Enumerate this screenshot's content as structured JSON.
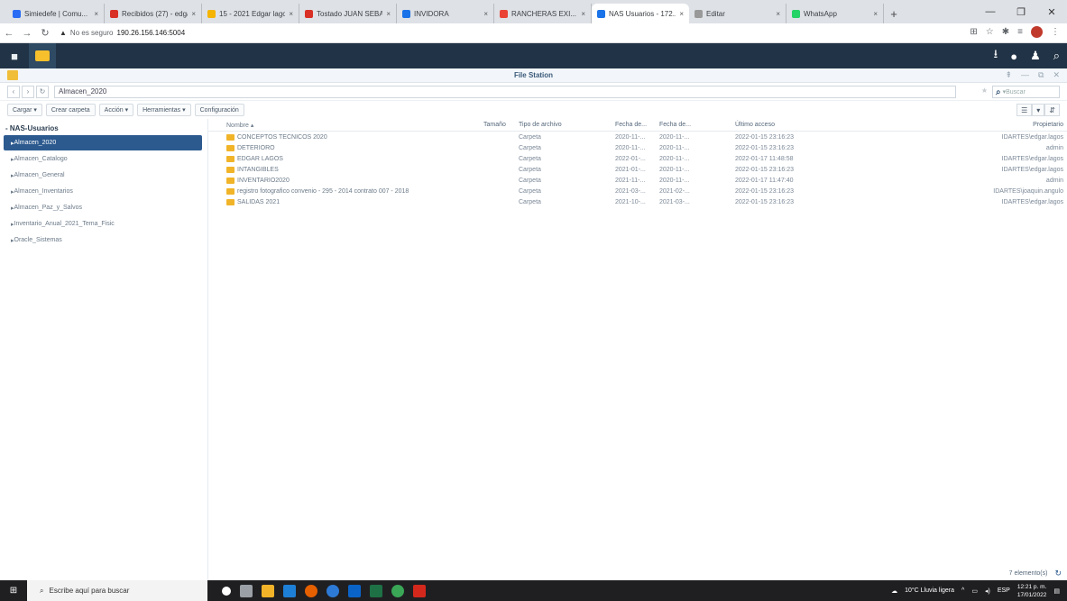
{
  "browser": {
    "tabs": [
      {
        "label": "Simiedefe | Comu...",
        "color": "#2a6df4",
        "active": false
      },
      {
        "label": "Recibidos (27) - edga...",
        "color": "#d93025",
        "active": false
      },
      {
        "label": "15 - 2021 Edgar lagos ...",
        "color": "#f4b400",
        "active": false
      },
      {
        "label": "Tostado JUAN SEBAS...",
        "color": "#d93025",
        "active": false
      },
      {
        "label": "INVIDORA",
        "color": "#1a73e8",
        "active": false
      },
      {
        "label": "RANCHERAS EXI...",
        "color": "#ea4335",
        "active": false
      },
      {
        "label": "NAS Usuarios - 172...",
        "color": "#1a73e8",
        "active": true
      },
      {
        "label": "Editar",
        "color": "#999999",
        "active": false
      },
      {
        "label": "WhatsApp",
        "color": "#25d366",
        "active": false
      }
    ],
    "url_warning": "No es seguro",
    "url_host": "190.26.156.146:5004"
  },
  "app": {
    "title": "File Station",
    "path": "Almacen_2020",
    "search_placeholder": "Buscar"
  },
  "toolbar": {
    "upload": "Cargar ▾",
    "create_folder": "Crear carpeta",
    "action": "Acción ▾",
    "tools": "Herramientas ▾",
    "settings": "Configuración"
  },
  "sidebar": {
    "root": "NAS-Usuarios",
    "items": [
      {
        "label": "Almacen_2020",
        "selected": true
      },
      {
        "label": "Almacen_Catalogo",
        "selected": false
      },
      {
        "label": "Almacen_General",
        "selected": false
      },
      {
        "label": "Almacen_Inventarios",
        "selected": false
      },
      {
        "label": "Almacen_Paz_y_Salvos",
        "selected": false
      },
      {
        "label": "Inventario_Anual_2021_Tema_Fisic",
        "selected": false
      },
      {
        "label": "Oracle_Sistemas",
        "selected": false
      }
    ]
  },
  "table": {
    "headers": [
      "Nombre ▴",
      "Tamaño",
      "Tipo de archivo",
      "Fecha de...",
      "Fecha de...",
      "Último acceso",
      "Propietario"
    ],
    "rows": [
      {
        "name": "CONCEPTOS TECNICOS 2020",
        "size": "",
        "type": "Carpeta",
        "d1": "2020-11-...",
        "d2": "2020-11-...",
        "last": "2022-01-15 23:16:23",
        "owner": "IDARTES\\edgar.lagos"
      },
      {
        "name": "DETERIORO",
        "size": "",
        "type": "Carpeta",
        "d1": "2020-11-...",
        "d2": "2020-11-...",
        "last": "2022-01-15 23:16:23",
        "owner": "admin"
      },
      {
        "name": "EDGAR LAGOS",
        "size": "",
        "type": "Carpeta",
        "d1": "2022-01-...",
        "d2": "2020-11-...",
        "last": "2022-01-17 11:48:58",
        "owner": "IDARTES\\edgar.lagos"
      },
      {
        "name": "INTANGIBLES",
        "size": "",
        "type": "Carpeta",
        "d1": "2021-01-...",
        "d2": "2020-11-...",
        "last": "2022-01-15 23:16:23",
        "owner": "IDARTES\\edgar.lagos"
      },
      {
        "name": "INVENTARIO2020",
        "size": "",
        "type": "Carpeta",
        "d1": "2021-11-...",
        "d2": "2020-11-...",
        "last": "2022-01-17 11:47:40",
        "owner": "admin"
      },
      {
        "name": "registro fotografico convenio - 295 - 2014 contrato 007 - 2018",
        "size": "",
        "type": "Carpeta",
        "d1": "2021-03-...",
        "d2": "2021-02-...",
        "last": "2022-01-15 23:16:23",
        "owner": "IDARTES\\joaquin.angulo"
      },
      {
        "name": "SALIDAS 2021",
        "size": "",
        "type": "Carpeta",
        "d1": "2021-10-...",
        "d2": "2021-03-...",
        "last": "2022-01-15 23:16:23",
        "owner": "IDARTES\\edgar.lagos"
      }
    ]
  },
  "status": {
    "count": "7 elemento(s)"
  },
  "taskbar": {
    "search_text": "Escribe aquí para buscar",
    "weather": "10°C Lluvia ligera",
    "lang": "ESP",
    "time": "12:21 p. m.",
    "date": "17/01/2022"
  }
}
